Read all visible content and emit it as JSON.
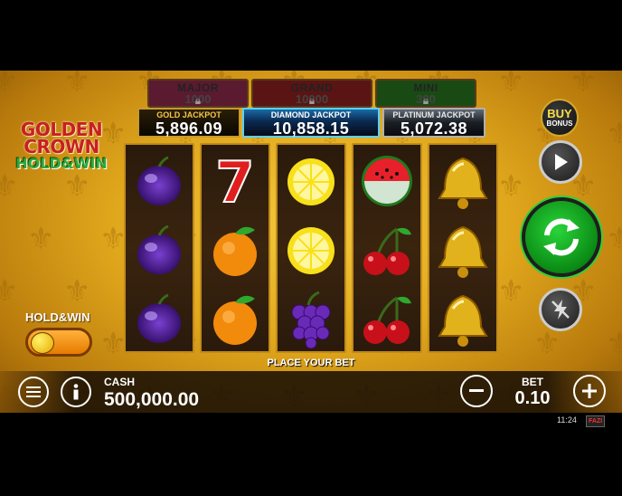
{
  "game": {
    "logo_line1": "GOLDEN",
    "logo_line2": "CROWN",
    "logo_line3": "HOLD&WIN"
  },
  "locked_jackpots": [
    {
      "label": "MAJOR",
      "value": "1000",
      "color": "#5a1a30"
    },
    {
      "label": "GRAND",
      "value": "10000",
      "color": "#5a1414"
    },
    {
      "label": "MINI",
      "value": "300",
      "color": "#1a4a14"
    }
  ],
  "jackpots": [
    {
      "label": "GOLD JACKPOT",
      "value": "5,896.09",
      "label_color": "#f5c84a"
    },
    {
      "label": "DIAMOND JACKPOT",
      "value": "10,858.15",
      "label_color": "#ffffff"
    },
    {
      "label": "PLATINUM JACKPOT",
      "value": "5,072.38",
      "label_color": "#e0e0e0"
    }
  ],
  "reels": [
    [
      "plum",
      "plum",
      "plum"
    ],
    [
      "seven",
      "orange",
      "orange"
    ],
    [
      "lemon",
      "lemon",
      "grapes"
    ],
    [
      "watermelon",
      "cherries",
      "cherries"
    ],
    [
      "bell",
      "bell",
      "bell"
    ]
  ],
  "status_text": "PLACE YOUR BET",
  "hold_win": {
    "label": "HOLD&WIN",
    "enabled": false
  },
  "buttons": {
    "buy_bonus_line1": "BUY",
    "buy_bonus_line2": "BONUS",
    "menu_icon": "hamburger-icon",
    "info_icon": "info-icon",
    "minus_icon": "minus-icon",
    "plus_icon": "plus-icon",
    "autoplay_icon": "play-icon",
    "spin_icon": "spin-arrows-icon",
    "turbo_icon": "lightning-off-icon"
  },
  "cash": {
    "label": "CASH",
    "value": "500,000.00"
  },
  "bet": {
    "label": "BET",
    "value": "0.10"
  },
  "status_bar": {
    "time": "11:24",
    "brand": "FAZI"
  },
  "colors": {
    "background": "#e0a71c",
    "spin": "#1fb22a",
    "accent": "#f5c84a"
  }
}
